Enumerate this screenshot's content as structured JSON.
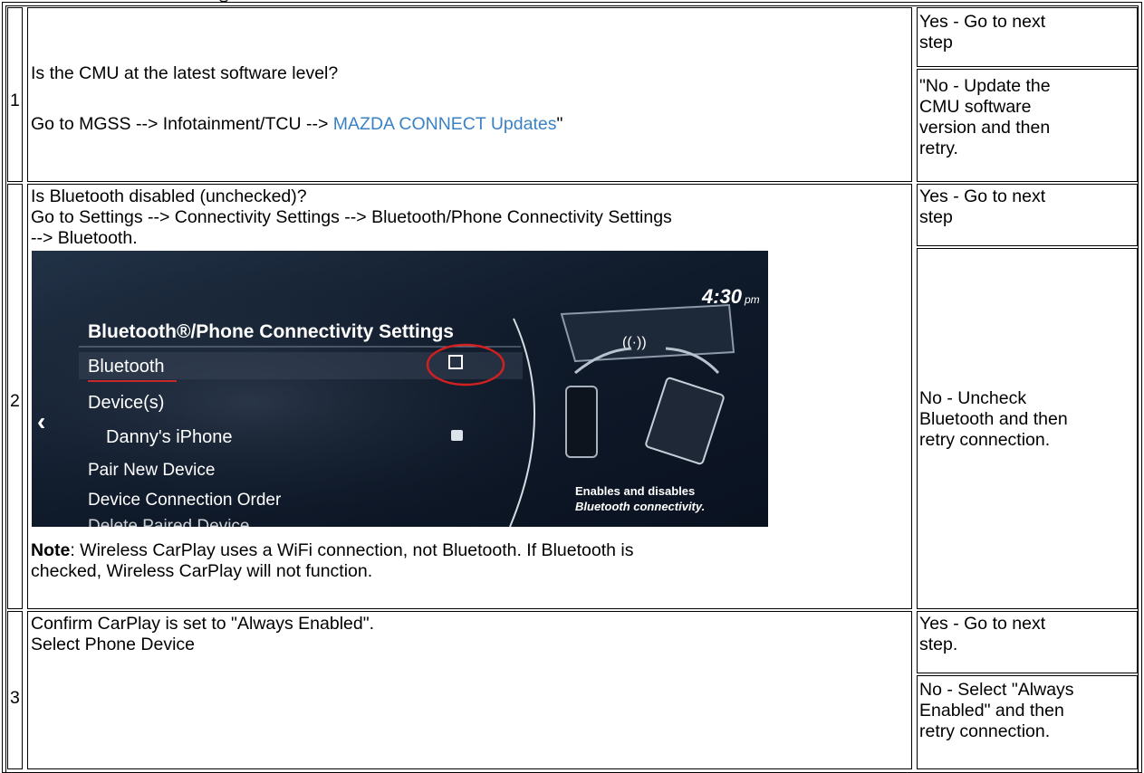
{
  "rows": [
    {
      "num": "1",
      "question_lines": [
        "Is the CMU at the latest software level?"
      ],
      "path_prefix": "Go to MGSS --> Infotainment/TCU --> ",
      "path_link": "MAZDA CONNECT Updates",
      "path_suffix": "\"",
      "yes_lines": [
        "Yes - Go to next",
        "step"
      ],
      "no_lines": [
        "\"No - Update the",
        "CMU software",
        "version and then",
        "retry."
      ]
    },
    {
      "num": "2",
      "question_lines": [
        "Is Bluetooth disabled (unchecked)?",
        "Go to Settings --> Connectivity Settings --> Bluetooth/Phone Connectivity Settings",
        "--> Bluetooth."
      ],
      "note_label": "Note",
      "note_lines": [
        ": Wireless CarPlay uses a WiFi connection, not Bluetooth. If Bluetooth is",
        "checked, Wireless CarPlay will not function."
      ],
      "yes_lines": [
        "Yes - Go to next",
        "step"
      ],
      "no_lines": [
        "No - Uncheck",
        "Bluetooth and then",
        "retry connection."
      ],
      "screen": {
        "clock": "4:30",
        "clock_suffix": "pm",
        "title": "Bluetooth®/Phone Connectivity Settings",
        "items": [
          "Bluetooth",
          "Device(s)",
          "Danny's iPhone",
          "Pair New Device",
          "Device Connection Order",
          "Delete Paired Device"
        ],
        "help_lines": [
          "Enables and disables",
          "Bluetooth connectivity."
        ],
        "back_glyph": "‹"
      }
    },
    {
      "num": "3",
      "question_lines": [
        "Confirm CarPlay is set to \"Always Enabled\".",
        "Select Phone Device"
      ],
      "yes_lines": [
        "Yes - Go to next",
        "step."
      ],
      "no_lines": [
        "No - Select \"Always",
        "Enabled\" and then",
        "retry connection."
      ]
    }
  ]
}
